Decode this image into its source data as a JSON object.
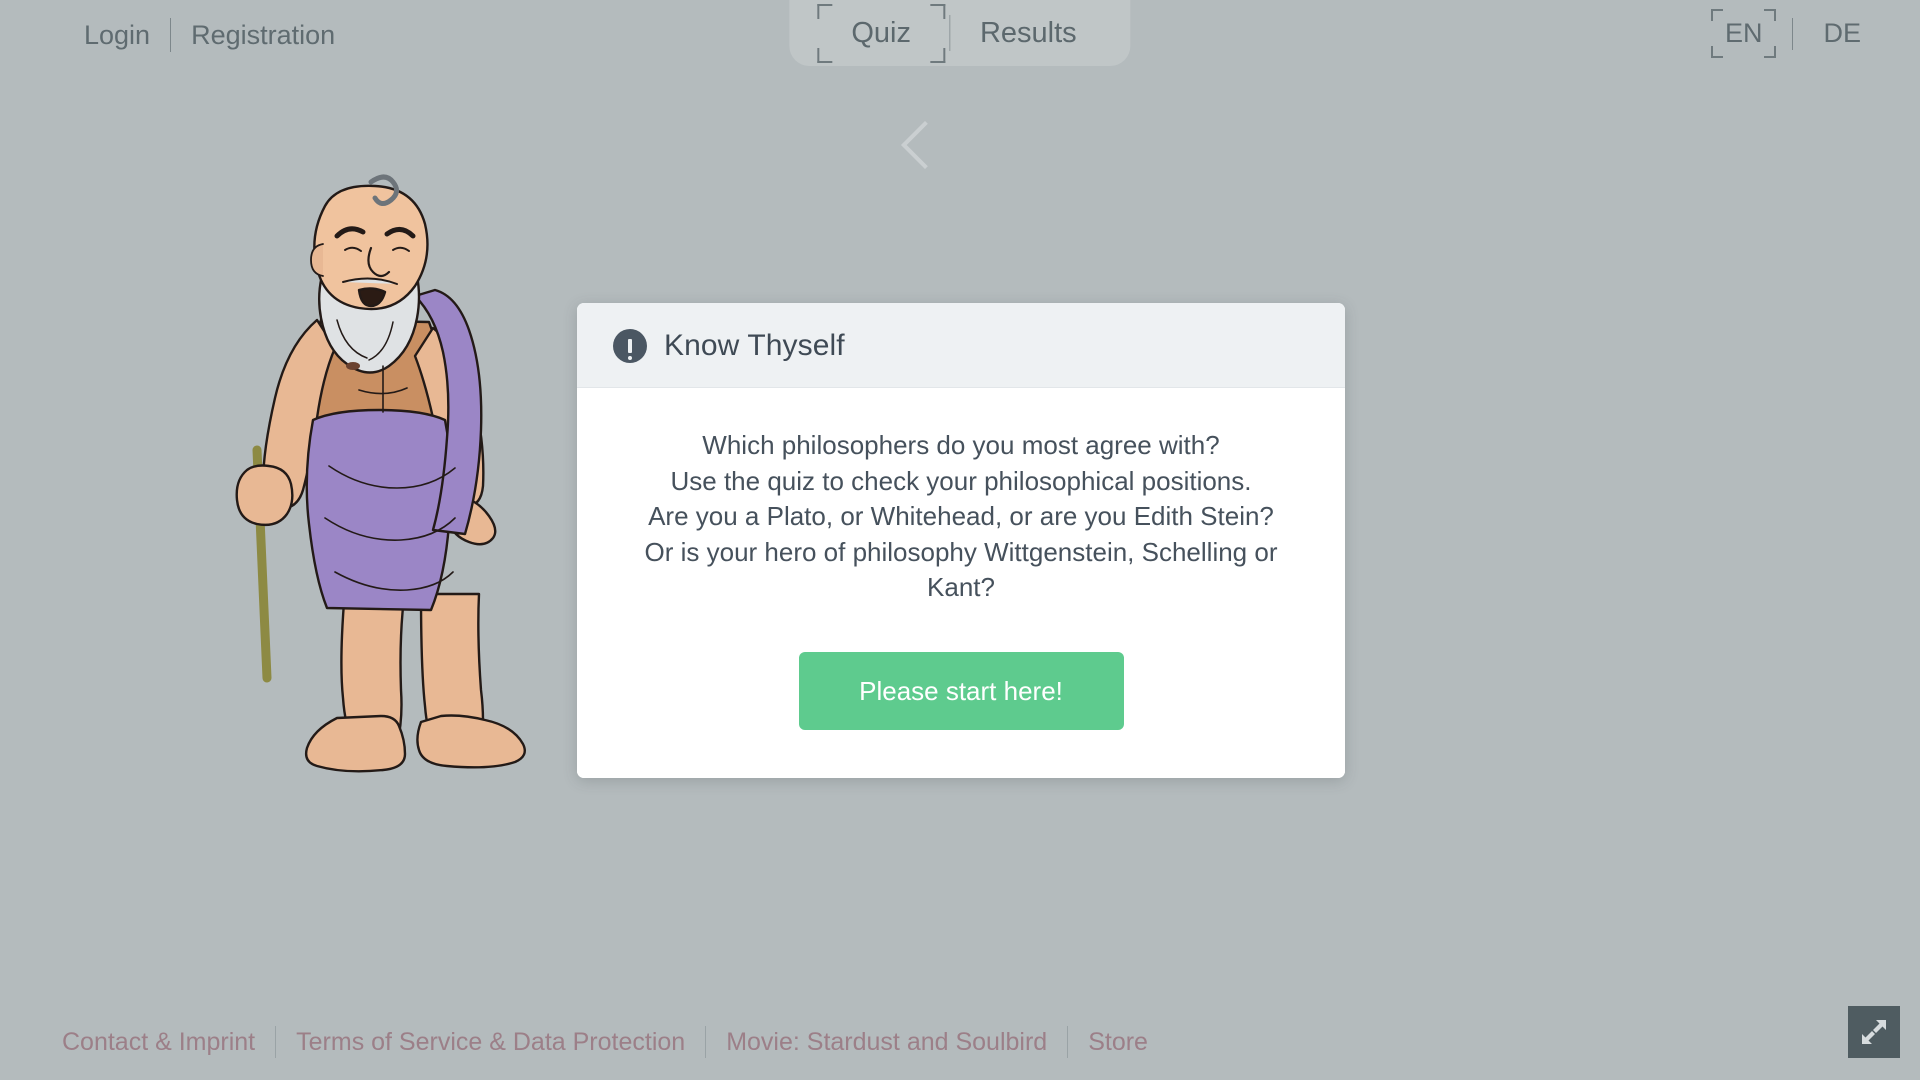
{
  "page": {
    "background_color": "#b4bbbd",
    "text_color": "#5f6b70"
  },
  "topbar": {
    "auth": {
      "login_label": "Login",
      "registration_label": "Registration"
    },
    "tabs": [
      {
        "label": "Quiz",
        "selected": true
      },
      {
        "label": "Results",
        "selected": false
      }
    ],
    "language": {
      "options": [
        {
          "label": "EN",
          "selected": true
        },
        {
          "label": "DE",
          "selected": false
        }
      ]
    }
  },
  "nav": {
    "back_icon": "chevron-left-icon"
  },
  "character": {
    "name": "socrates-illustration",
    "skin_color": "#e8b894",
    "robe_color": "#9b86c6",
    "beard_color": "#dfe2e4",
    "staff_color": "#8d8a43"
  },
  "modal": {
    "icon": "alert-circle-icon",
    "icon_color": "#4b5763",
    "title": "Know Thyself",
    "header_bg": "#eef1f3",
    "body_lines": [
      "Which philosophers do you most agree with?",
      "Use the quiz to check your philosophical positions.",
      "Are you a Plato, or Whitehead, or are you Edith Stein?",
      "Or is your hero of philosophy Wittgenstein, Schelling or Kant?"
    ],
    "start_button": {
      "label": "Please start here!",
      "color": "#5ecb8e"
    }
  },
  "footer": {
    "link_color": "#9c7f88",
    "links": [
      {
        "label": "Contact & Imprint"
      },
      {
        "label": "Terms of Service & Data Protection"
      },
      {
        "label": "Movie: Stardust and Soulbird"
      },
      {
        "label": "Store"
      }
    ]
  },
  "fullscreen_button": {
    "icon": "expand-arrows-icon",
    "background": "#4f5c61"
  }
}
